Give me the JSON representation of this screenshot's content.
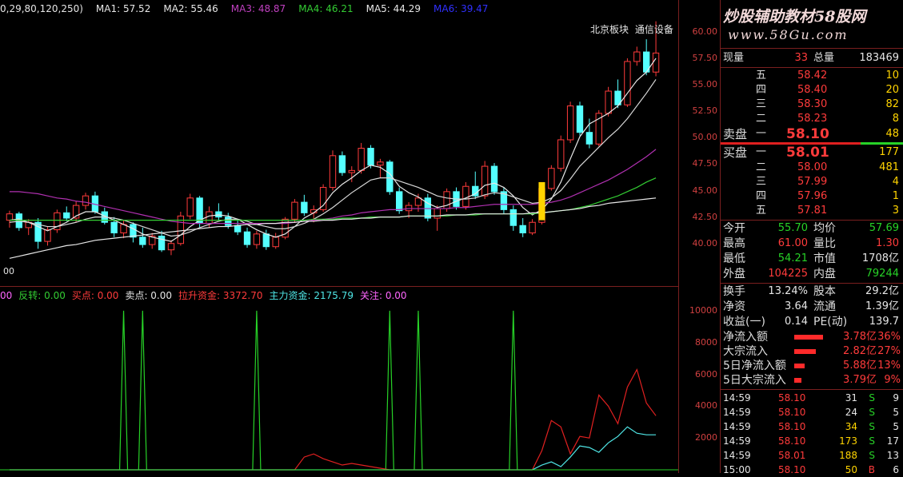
{
  "main_header": {
    "params": "0,29,80,120,250)",
    "ma": [
      {
        "label": "MA1: 57.52",
        "color": "#e8e8e8"
      },
      {
        "label": "MA2: 55.46",
        "color": "#e8e8e8"
      },
      {
        "label": "MA3: 48.87",
        "color": "#c040c0"
      },
      {
        "label": "MA4: 46.21",
        "color": "#33cc33"
      },
      {
        "label": "MA5: 44.29",
        "color": "#e8e8e8"
      },
      {
        "label": "MA6: 39.47",
        "color": "#3030ff"
      }
    ]
  },
  "overlay": {
    "label_overlap": "北京板块",
    "label_sector": "通信设备"
  },
  "bottom_left_label": "00",
  "price_axis": [
    "60.00",
    "57.50",
    "55.00",
    "52.50",
    "50.00",
    "47.50",
    "45.00",
    "42.50",
    "40.00"
  ],
  "indicator_header": [
    {
      "label": "00",
      "color": "#ff66ff"
    },
    {
      "label": "反转: 0.00",
      "color": "#33cc33"
    },
    {
      "label": "买点: 0.00",
      "color": "#ff3b3b"
    },
    {
      "label": "卖点: 0.00",
      "color": "#e6e6e6"
    },
    {
      "label": "拉升资金: 3372.70",
      "color": "#ff3b3b"
    },
    {
      "label": "主力资金: 2175.79",
      "color": "#4fe6e6"
    },
    {
      "label": "关注: 0.00",
      "color": "#ff66ff"
    }
  ],
  "indicator_axis": [
    "10000",
    "8000",
    "6000",
    "4000",
    "2000"
  ],
  "logo": {
    "title": "炒股辅助教材58股网",
    "url": "www.58Gu.com"
  },
  "quote": {
    "volume_now_label": "现量",
    "volume_now": "33",
    "volume_total_label": "总量",
    "volume_total": "183469",
    "asks": [
      {
        "label": "五",
        "price": "58.42",
        "vol": "10"
      },
      {
        "label": "四",
        "price": "58.40",
        "vol": "20"
      },
      {
        "label": "三",
        "price": "58.30",
        "vol": "82"
      },
      {
        "label": "二",
        "price": "58.23",
        "vol": "8"
      }
    ],
    "ask1": {
      "label": "卖盘",
      "level": "一",
      "price": "58.10",
      "vol": "48"
    },
    "bid1": {
      "label": "买盘",
      "level": "一",
      "price": "58.01",
      "vol": "177"
    },
    "bids": [
      {
        "label": "二",
        "price": "58.00",
        "vol": "481"
      },
      {
        "label": "三",
        "price": "57.99",
        "vol": "4"
      },
      {
        "label": "四",
        "price": "57.96",
        "vol": "1"
      },
      {
        "label": "五",
        "price": "57.81",
        "vol": "3"
      }
    ],
    "stats": [
      {
        "l1": "今开",
        "v1": "55.70",
        "c1": "green",
        "l2": "均价",
        "v2": "57.69",
        "c2": "green"
      },
      {
        "l1": "最高",
        "v1": "61.00",
        "c1": "red",
        "l2": "量比",
        "v2": "1.30",
        "c2": "red"
      },
      {
        "l1": "最低",
        "v1": "54.21",
        "c1": "green",
        "l2": "市值",
        "v2": "1708亿",
        "c2": "white"
      },
      {
        "l1": "外盘",
        "v1": "104225",
        "c1": "red",
        "l2": "内盘",
        "v2": "79244",
        "c2": "green"
      }
    ],
    "stats2": [
      {
        "l1": "换手",
        "v1": "13.24%",
        "l2": "股本",
        "v2": "29.2亿"
      },
      {
        "l1": "净资",
        "v1": "3.64",
        "l2": "流通",
        "v2": "1.39亿"
      },
      {
        "l1": "收益(一)",
        "v1": "0.14",
        "l2": "PE(动)",
        "v2": "139.7"
      }
    ],
    "flows": [
      {
        "label": "净流入额",
        "amount": "3.78亿",
        "pct": "36%",
        "bar": 0.36
      },
      {
        "label": "大宗流入",
        "amount": "2.82亿",
        "pct": "27%",
        "bar": 0.27
      },
      {
        "label": "5日净流入额",
        "amount": "5.88亿",
        "pct": "13%",
        "bar": 0.13
      },
      {
        "label": "5日大宗流入",
        "amount": "3.79亿",
        "pct": "9%",
        "bar": 0.09
      }
    ],
    "ticks": [
      {
        "time": "14:59",
        "price": "58.10",
        "vol": "31",
        "side": "S",
        "n": "9",
        "vcolor": "white"
      },
      {
        "time": "14:59",
        "price": "58.10",
        "vol": "24",
        "side": "S",
        "n": "5",
        "vcolor": "white"
      },
      {
        "time": "14:59",
        "price": "58.10",
        "vol": "34",
        "side": "S",
        "n": "5",
        "vcolor": "yellow"
      },
      {
        "time": "14:59",
        "price": "58.10",
        "vol": "173",
        "side": "S",
        "n": "17",
        "vcolor": "yellow"
      },
      {
        "time": "14:59",
        "price": "58.01",
        "vol": "188",
        "side": "S",
        "n": "13",
        "vcolor": "yellow"
      },
      {
        "time": "15:00",
        "price": "58.10",
        "vol": "50",
        "side": "B",
        "n": "6",
        "vcolor": "yellow"
      }
    ]
  },
  "chart_data": {
    "type": "line",
    "title": "",
    "xlabel": "",
    "ylabel": "",
    "ylim": [
      39,
      61.5
    ],
    "candles": [
      [
        42.2,
        43.1,
        41.5,
        42.8
      ],
      [
        42.8,
        43.0,
        41.2,
        41.5
      ],
      [
        41.5,
        42.3,
        40.8,
        42.0
      ],
      [
        42.0,
        42.4,
        39.5,
        40.2
      ],
      [
        40.2,
        41.6,
        39.8,
        41.3
      ],
      [
        41.3,
        43.2,
        41.0,
        42.9
      ],
      [
        42.9,
        43.5,
        42.1,
        42.4
      ],
      [
        42.4,
        44.0,
        42.0,
        43.6
      ],
      [
        43.6,
        44.8,
        43.2,
        44.5
      ],
      [
        44.5,
        44.9,
        42.8,
        43.0
      ],
      [
        43.0,
        43.4,
        41.8,
        42.0
      ],
      [
        42.0,
        42.5,
        40.6,
        41.0
      ],
      [
        41.0,
        42.2,
        40.5,
        41.8
      ],
      [
        41.8,
        42.0,
        40.1,
        40.6
      ],
      [
        40.6,
        41.5,
        39.6,
        39.9
      ],
      [
        39.9,
        41.0,
        39.5,
        40.7
      ],
      [
        40.7,
        41.2,
        39.2,
        39.4
      ],
      [
        39.4,
        40.3,
        38.9,
        40.0
      ],
      [
        40.0,
        43.0,
        39.8,
        42.6
      ],
      [
        42.6,
        44.7,
        42.3,
        44.3
      ],
      [
        44.3,
        44.5,
        41.5,
        41.9
      ],
      [
        41.9,
        43.5,
        41.5,
        43.0
      ],
      [
        43.0,
        43.8,
        42.2,
        42.5
      ],
      [
        42.5,
        42.9,
        41.4,
        41.7
      ],
      [
        41.7,
        42.3,
        40.8,
        41.1
      ],
      [
        41.1,
        41.5,
        39.6,
        39.9
      ],
      [
        39.9,
        41.2,
        39.5,
        40.9
      ],
      [
        40.9,
        41.3,
        39.4,
        39.7
      ],
      [
        39.7,
        41.0,
        39.5,
        40.6
      ],
      [
        40.6,
        42.5,
        40.4,
        42.3
      ],
      [
        42.3,
        44.2,
        42.0,
        43.9
      ],
      [
        43.9,
        44.6,
        42.6,
        42.9
      ],
      [
        42.9,
        43.6,
        42.0,
        43.2
      ],
      [
        43.2,
        45.6,
        43.0,
        45.3
      ],
      [
        45.3,
        48.8,
        45.0,
        48.3
      ],
      [
        48.3,
        48.7,
        46.4,
        46.7
      ],
      [
        46.7,
        47.3,
        45.8,
        46.9
      ],
      [
        46.9,
        49.5,
        46.6,
        49.0
      ],
      [
        49.0,
        49.3,
        47.1,
        47.4
      ],
      [
        47.4,
        48.0,
        46.2,
        47.7
      ],
      [
        47.7,
        47.9,
        44.6,
        44.9
      ],
      [
        44.9,
        45.3,
        42.8,
        43.1
      ],
      [
        43.1,
        43.9,
        42.4,
        43.6
      ],
      [
        43.6,
        44.7,
        43.0,
        44.3
      ],
      [
        44.3,
        44.7,
        42.1,
        42.4
      ],
      [
        42.4,
        43.6,
        41.2,
        43.3
      ],
      [
        43.3,
        45.2,
        43.0,
        44.9
      ],
      [
        44.9,
        45.3,
        43.2,
        43.5
      ],
      [
        43.5,
        45.8,
        43.2,
        45.4
      ],
      [
        45.4,
        46.8,
        44.2,
        44.5
      ],
      [
        44.5,
        47.8,
        44.2,
        47.3
      ],
      [
        47.3,
        47.6,
        44.6,
        44.9
      ],
      [
        44.9,
        45.3,
        42.8,
        43.2
      ],
      [
        43.2,
        43.6,
        41.2,
        41.7
      ],
      [
        41.7,
        42.4,
        40.6,
        41.0
      ],
      [
        41.0,
        42.3,
        40.8,
        42.0
      ],
      [
        42.0,
        45.4,
        41.8,
        45.2
      ],
      [
        45.2,
        47.4,
        45.0,
        47.1
      ],
      [
        47.1,
        50.2,
        46.8,
        49.8
      ],
      [
        49.8,
        53.4,
        49.5,
        53.0
      ],
      [
        53.0,
        53.4,
        50.2,
        50.5
      ],
      [
        50.5,
        51.8,
        49.0,
        49.4
      ],
      [
        49.4,
        52.6,
        49.2,
        52.3
      ],
      [
        52.3,
        54.8,
        52.0,
        54.4
      ],
      [
        54.4,
        55.5,
        52.8,
        53.1
      ],
      [
        53.1,
        57.5,
        52.9,
        57.2
      ],
      [
        57.2,
        58.6,
        56.8,
        58.1
      ],
      [
        58.1,
        59.3,
        55.9,
        56.2
      ],
      [
        56.2,
        61.0,
        55.8,
        58.0
      ]
    ],
    "ma_lines": [
      {
        "name": "MA1",
        "color": "#e8e8e8",
        "values": [
          42.2,
          42.3,
          42.0,
          41.6,
          41.2,
          41.6,
          42.0,
          42.6,
          43.0,
          43.0,
          42.6,
          42.2,
          41.8,
          41.4,
          40.9,
          40.6,
          40.4,
          40.2,
          40.8,
          41.6,
          42.2,
          42.6,
          42.7,
          42.6,
          42.3,
          41.8,
          41.3,
          40.9,
          40.6,
          40.9,
          41.6,
          42.4,
          42.9,
          43.6,
          44.8,
          45.6,
          46.2,
          46.9,
          47.4,
          47.2,
          46.6,
          45.4,
          44.8,
          44.4,
          43.8,
          43.4,
          43.6,
          44.0,
          44.3,
          44.7,
          45.5,
          45.7,
          45.3,
          44.5,
          43.4,
          42.7,
          43.2,
          44.2,
          45.8,
          48.0,
          50.1,
          51.3,
          51.8,
          52.3,
          53.0,
          54.2,
          55.4,
          56.2,
          57.5
        ]
      },
      {
        "name": "MA2",
        "color": "#d8d8d8",
        "values": [
          42.0,
          42.1,
          42.0,
          41.8,
          41.6,
          41.6,
          41.8,
          42.0,
          42.3,
          42.5,
          42.5,
          42.4,
          42.2,
          41.9,
          41.6,
          41.3,
          41.0,
          40.7,
          40.8,
          41.1,
          41.5,
          41.8,
          42.1,
          42.3,
          42.3,
          42.1,
          41.8,
          41.6,
          41.4,
          41.4,
          41.6,
          41.9,
          42.3,
          42.8,
          43.4,
          44.1,
          44.8,
          45.4,
          46.0,
          46.2,
          46.2,
          45.9,
          45.6,
          45.3,
          44.9,
          44.5,
          44.3,
          44.2,
          44.2,
          44.3,
          44.6,
          44.8,
          44.7,
          44.4,
          44.1,
          43.8,
          43.9,
          44.3,
          45.0,
          46.1,
          47.3,
          48.2,
          49.1,
          50.0,
          50.8,
          51.8,
          53.0,
          54.2,
          55.5
        ]
      },
      {
        "name": "MA3",
        "color": "#b030b0",
        "values": [
          44.9,
          44.9,
          44.8,
          44.7,
          44.5,
          44.3,
          44.2,
          44.0,
          43.9,
          43.7,
          43.5,
          43.3,
          43.1,
          42.9,
          42.7,
          42.5,
          42.3,
          42.1,
          42.0,
          41.9,
          41.9,
          41.9,
          41.9,
          41.9,
          41.9,
          41.9,
          41.9,
          41.9,
          41.9,
          41.9,
          42.0,
          42.1,
          42.2,
          42.3,
          42.4,
          42.6,
          42.7,
          42.9,
          43.0,
          43.1,
          43.2,
          43.2,
          43.3,
          43.3,
          43.3,
          43.3,
          43.3,
          43.4,
          43.4,
          43.5,
          43.6,
          43.7,
          43.7,
          43.7,
          43.7,
          43.7,
          43.8,
          43.9,
          44.1,
          44.4,
          44.8,
          45.2,
          45.6,
          46.0,
          46.5,
          47.0,
          47.6,
          48.2,
          48.9
        ]
      },
      {
        "name": "MA4",
        "color": "#33cc33",
        "values": [
          42.2,
          42.2,
          42.2,
          42.2,
          42.2,
          42.2,
          42.2,
          42.2,
          42.2,
          42.2,
          42.2,
          42.2,
          42.2,
          42.2,
          42.2,
          42.2,
          42.2,
          42.2,
          42.2,
          42.2,
          42.2,
          42.2,
          42.2,
          42.2,
          42.2,
          42.2,
          42.2,
          42.2,
          42.2,
          42.2,
          42.2,
          42.2,
          42.3,
          42.3,
          42.3,
          42.4,
          42.4,
          42.4,
          42.5,
          42.5,
          42.5,
          42.5,
          42.6,
          42.6,
          42.6,
          42.6,
          42.6,
          42.7,
          42.7,
          42.7,
          42.8,
          42.8,
          42.8,
          42.8,
          42.8,
          42.8,
          42.9,
          43.0,
          43.1,
          43.2,
          43.4,
          43.6,
          43.9,
          44.2,
          44.5,
          44.9,
          45.3,
          45.8,
          46.2
        ]
      },
      {
        "name": "MA5",
        "color": "#e8e8e8",
        "values": [
          38.6,
          38.8,
          39.0,
          39.2,
          39.4,
          39.6,
          39.8,
          39.9,
          40.1,
          40.3,
          40.4,
          40.5,
          40.6,
          40.7,
          40.8,
          40.9,
          41.0,
          41.1,
          41.2,
          41.3,
          41.4,
          41.5,
          41.6,
          41.6,
          41.7,
          41.8,
          41.8,
          41.9,
          41.9,
          42.0,
          42.0,
          42.1,
          42.1,
          42.2,
          42.2,
          42.3,
          42.3,
          42.4,
          42.4,
          42.5,
          42.5,
          42.5,
          42.6,
          42.6,
          42.6,
          42.6,
          42.7,
          42.7,
          42.7,
          42.8,
          42.8,
          42.8,
          42.8,
          42.8,
          42.8,
          42.9,
          42.9,
          43.0,
          43.1,
          43.2,
          43.3,
          43.5,
          43.6,
          43.8,
          43.9,
          44.0,
          44.1,
          44.2,
          44.3
        ]
      }
    ],
    "signal_bar": {
      "index": 56,
      "low": 42.2,
      "high": 45.8
    },
    "indicator": {
      "ylim": [
        0,
        11000
      ],
      "green_spikes": [
        12,
        14,
        26,
        40,
        43,
        53
      ],
      "red_line": [
        0,
        0,
        0,
        0,
        0,
        0,
        0,
        0,
        0,
        0,
        0,
        0,
        0,
        0,
        0,
        0,
        0,
        0,
        0,
        0,
        0,
        0,
        0,
        0,
        0,
        0,
        0,
        0,
        0,
        0,
        0,
        800,
        1000,
        700,
        500,
        300,
        400,
        300,
        200,
        100,
        0,
        0,
        0,
        0,
        0,
        0,
        0,
        0,
        0,
        0,
        0,
        0,
        0,
        0,
        0,
        0,
        1200,
        3100,
        2700,
        1000,
        2100,
        2000,
        4700,
        4000,
        2900,
        5200,
        6300,
        4200,
        3400
      ],
      "cyan_line": [
        0,
        0,
        0,
        0,
        0,
        0,
        0,
        0,
        0,
        0,
        0,
        0,
        0,
        0,
        0,
        0,
        0,
        0,
        0,
        0,
        0,
        0,
        0,
        0,
        0,
        0,
        0,
        0,
        0,
        0,
        0,
        0,
        0,
        0,
        0,
        0,
        0,
        0,
        0,
        0,
        0,
        0,
        0,
        0,
        0,
        0,
        0,
        0,
        0,
        0,
        0,
        0,
        0,
        0,
        0,
        0,
        300,
        500,
        200,
        800,
        1500,
        1400,
        1100,
        1700,
        2100,
        2700,
        2300,
        2200,
        2200
      ]
    }
  }
}
